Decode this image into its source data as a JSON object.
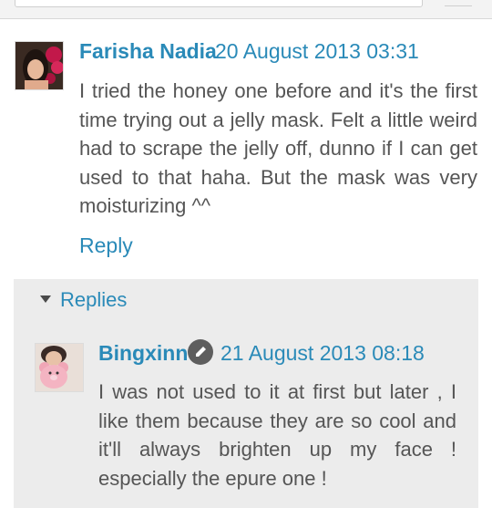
{
  "comment": {
    "author": "Farisha Nadia",
    "date": "20 August 2013 03:31",
    "text": "I tried the honey one before and it's the first time trying out a jelly mask. Felt a little weird had to scrape the jelly off, dunno if I can get used to that haha. But the mask was very moisturizing ^^",
    "reply_label": "Reply",
    "avatar_icon": "user-photo-icon"
  },
  "replies": {
    "label": "Replies",
    "toggle_icon": "triangle-down-icon",
    "items": [
      {
        "author": "Bingxinn",
        "author_badge_icon": "pencil-icon",
        "date": "21 August 2013 08:18",
        "text": "I was not used to it at first but later , I like them because they are so cool and it'll always brighten up my face ! especially the epure one !",
        "avatar_icon": "user-photo-icon"
      }
    ]
  },
  "colors": {
    "link": "#2a8ab8",
    "text": "#555555",
    "panel": "#ececec"
  }
}
